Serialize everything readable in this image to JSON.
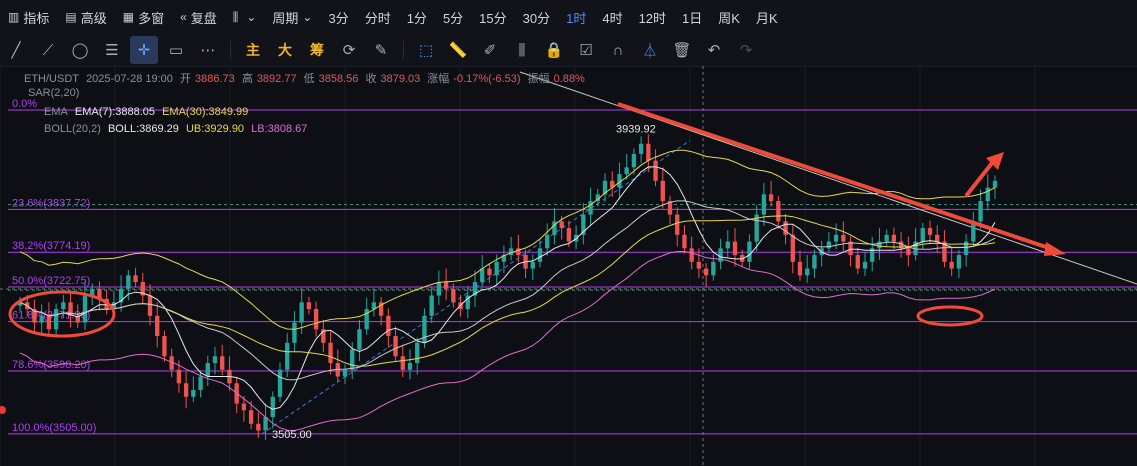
{
  "toolbar": {
    "items": [
      {
        "icon": "chart-bars-icon",
        "label": "指标"
      },
      {
        "icon": "calendar-icon",
        "label": "高级"
      },
      {
        "icon": "grid-icon",
        "label": "多窗"
      },
      {
        "icon": "rewind-icon",
        "label": "复盘"
      },
      {
        "icon": "candle-icon",
        "label": ""
      },
      {
        "icon": "",
        "label": "周期"
      },
      {
        "icon": "",
        "label": "3分"
      },
      {
        "icon": "",
        "label": "分时"
      },
      {
        "icon": "",
        "label": "1分"
      },
      {
        "icon": "",
        "label": "5分"
      },
      {
        "icon": "",
        "label": "15分"
      },
      {
        "icon": "",
        "label": "30分"
      },
      {
        "icon": "",
        "label": "1时"
      },
      {
        "icon": "",
        "label": "4时"
      },
      {
        "icon": "",
        "label": "12时"
      },
      {
        "icon": "",
        "label": "1日"
      },
      {
        "icon": "",
        "label": "周K"
      },
      {
        "icon": "",
        "label": "月K"
      }
    ],
    "active_period": "1时"
  },
  "drawbar": {
    "chinese_tools": [
      "主",
      "大",
      "筹"
    ]
  },
  "header": {
    "symbol": "ETH/USDT",
    "datetime": "2025-07-28 19:00",
    "open_label": "开",
    "open": "3886.73",
    "high_label": "高",
    "high": "3892.77",
    "low_label": "低",
    "low": "3858.56",
    "close_label": "收",
    "close": "3879.03",
    "change_label": "涨幅",
    "change": "-0.17%(-6.53)",
    "amp_label": "振幅",
    "amp": "0.88%"
  },
  "indicators": {
    "sar": "SAR(2,20)",
    "ema_name": "EMA",
    "ema7": "EMA(7):3888.05",
    "ema30": "EMA(30):3849.99",
    "boll_name": "BOLL(20,2)",
    "boll": "BOLL:3869.29",
    "ub": "UB:3929.90",
    "lb": "LB:3808.67"
  },
  "colors": {
    "up": "#26a69a",
    "down": "#ef5350",
    "fib": "#b23ff0",
    "trend": "#f04a3a",
    "ema7": "#e8e8e8",
    "ema30": "#e6d84a",
    "ub": "#e6d84a",
    "lb": "#e06bd0",
    "boll": "#c9c9c9"
  },
  "chart_data": {
    "type": "candlestick",
    "symbol": "ETH/USDT",
    "interval": "1时",
    "ylim": [
      3490,
      3985
    ],
    "fib_levels": [
      {
        "label": "0.0%",
        "value": 3985.0
      },
      {
        "label": "23.6%(3837.72)",
        "value": 3837.72
      },
      {
        "label": "38.2%(3774.19)",
        "value": 3774.19
      },
      {
        "label": "50.0%(3722.75)",
        "value": 3722.75
      },
      {
        "label": "61.8%(3671.36)",
        "value": 3671.36
      },
      {
        "label": "78.6%(3598.20)",
        "value": 3598.2
      },
      {
        "label": "100.0%(3505.00)",
        "value": 3505.0
      }
    ],
    "annotations": [
      {
        "text": "3939.92",
        "value": 3939.92
      },
      {
        "text": "3505.00",
        "value": 3505.0
      }
    ],
    "closes": [
      3700,
      3690,
      3670,
      3680,
      3660,
      3690,
      3700,
      3680,
      3670,
      3710,
      3720,
      3705,
      3690,
      3700,
      3720,
      3740,
      3730,
      3710,
      3680,
      3650,
      3620,
      3600,
      3580,
      3560,
      3570,
      3590,
      3610,
      3620,
      3600,
      3580,
      3550,
      3540,
      3520,
      3510,
      3530,
      3560,
      3600,
      3640,
      3670,
      3700,
      3690,
      3660,
      3640,
      3610,
      3590,
      3600,
      3630,
      3660,
      3690,
      3700,
      3680,
      3650,
      3620,
      3600,
      3610,
      3640,
      3680,
      3710,
      3730,
      3720,
      3700,
      3690,
      3710,
      3730,
      3750,
      3740,
      3760,
      3770,
      3780,
      3770,
      3750,
      3760,
      3780,
      3800,
      3820,
      3810,
      3790,
      3800,
      3830,
      3850,
      3860,
      3880,
      3870,
      3890,
      3900,
      3920,
      3935,
      3910,
      3880,
      3850,
      3830,
      3800,
      3780,
      3760,
      3750,
      3740,
      3760,
      3780,
      3790,
      3770,
      3760,
      3790,
      3830,
      3860,
      3850,
      3820,
      3800,
      3760,
      3740,
      3750,
      3770,
      3780,
      3790,
      3800,
      3790,
      3770,
      3750,
      3760,
      3780,
      3790,
      3800,
      3790,
      3780,
      3770,
      3790,
      3810,
      3800,
      3790,
      3760,
      3750,
      3770,
      3790,
      3820,
      3850,
      3870,
      3880
    ]
  }
}
